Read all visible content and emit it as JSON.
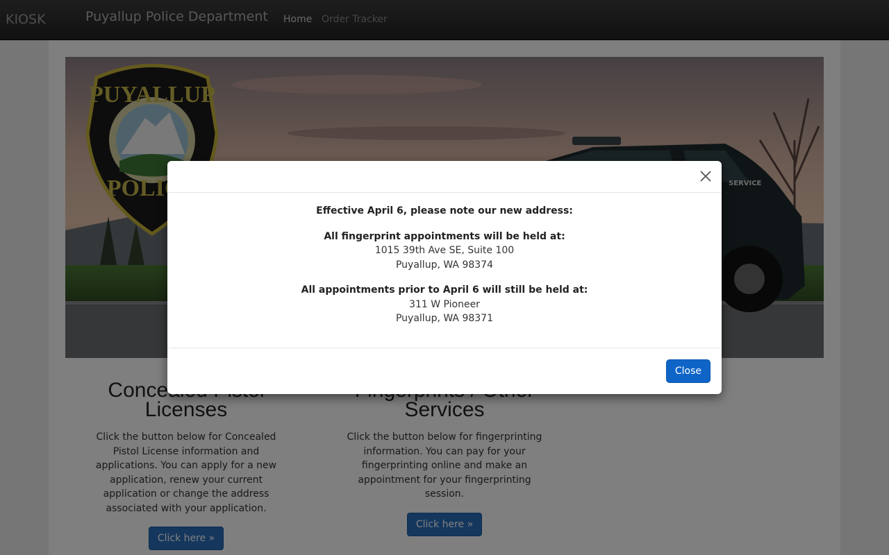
{
  "navbar": {
    "kiosk": "KIOSK",
    "title": "Puyallup Police Department",
    "home": "Home",
    "order_tracker": "Order Tracker"
  },
  "hero": {
    "badge_text_top": "PUYALLUP",
    "badge_text_bottom": "POLICE",
    "car_text": "SERVICE"
  },
  "cards": [
    {
      "title": "Concealed Pistol Licenses",
      "body": "Click the button below for Concealed Pistol License information and applications.  You can apply for a new application, renew your current application or change the address associated with your application.",
      "button": "Click here »"
    },
    {
      "title": "Fingerprints / Other Services",
      "body": "Click the button below for fingerprinting information. You can pay for your fingerprinting online and make an appointment for your fingerprinting session.",
      "button": "Click here »"
    }
  ],
  "modal": {
    "notice": "Effective April 6, please note our new address:",
    "new_heading": "All fingerprint appointments will be held at:",
    "new_line1": "1015 39th Ave SE, Suite 100",
    "new_line2": "Puyallup, WA 98374",
    "old_heading": "All appointments prior to April 6 will still be held at:",
    "old_line1": "311 W Pioneer",
    "old_line2": "Puyallup, WA 98371",
    "close_label": "Close"
  },
  "colors": {
    "navbar_bg": "#222222",
    "primary_button": "#0f65c7",
    "overlay": "rgba(0,0,0,0.5)"
  }
}
